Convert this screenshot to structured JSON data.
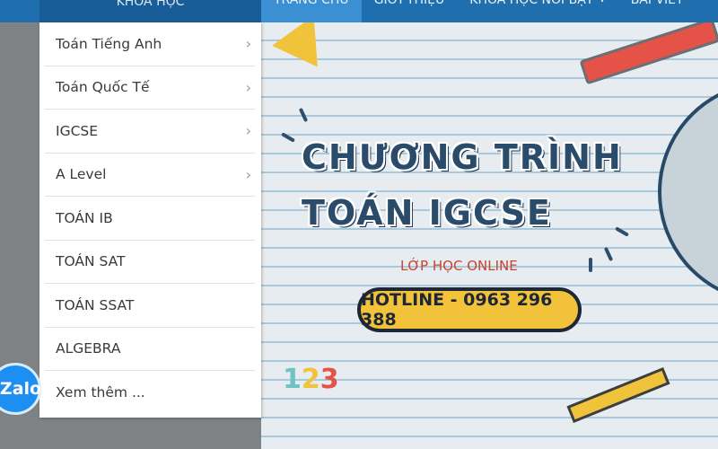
{
  "nav": {
    "category_header": "KHÓA HỌC",
    "items": [
      {
        "label": "TRANG CHỦ",
        "active": true,
        "has_dropdown": false
      },
      {
        "label": "GIỚI THIỆU",
        "active": false,
        "has_dropdown": false
      },
      {
        "label": "KHÓA HỌC NỔI BẬT",
        "active": false,
        "has_dropdown": true
      },
      {
        "label": "BÀI VIẾT",
        "active": false,
        "has_dropdown": false
      }
    ]
  },
  "dropdown": {
    "items": [
      {
        "label": "Toán Tiếng Anh",
        "has_submenu": true
      },
      {
        "label": "Toán Quốc Tế",
        "has_submenu": true
      },
      {
        "label": "IGCSE",
        "has_submenu": true
      },
      {
        "label": "A Level",
        "has_submenu": true
      },
      {
        "label": "TOÁN IB",
        "has_submenu": false
      },
      {
        "label": "TOÁN SAT",
        "has_submenu": false
      },
      {
        "label": "TOÁN SSAT",
        "has_submenu": false
      },
      {
        "label": "ALGEBRA",
        "has_submenu": false
      },
      {
        "label": "Xem thêm ...",
        "has_submenu": false
      }
    ]
  },
  "banner": {
    "title_line1": "CHƯƠNG TRÌNH",
    "title_line2": "TOÁN IGCSE",
    "subtitle": "LỚP HỌC ONLINE",
    "hotline": "HOTLINE - 0963 296 388",
    "numbers": {
      "one": "1",
      "two": "2",
      "three": "3"
    }
  },
  "zalo": {
    "label": "Zalo"
  },
  "icons": {
    "submenu_arrow": "chevron-right-icon",
    "nav_dropdown": "chevron-down-icon"
  },
  "colors": {
    "nav_bg": "#1f6fae",
    "nav_active": "#3b8fd3",
    "hotline_bg": "#f2c23a",
    "zalo": "#1e8ff2"
  }
}
